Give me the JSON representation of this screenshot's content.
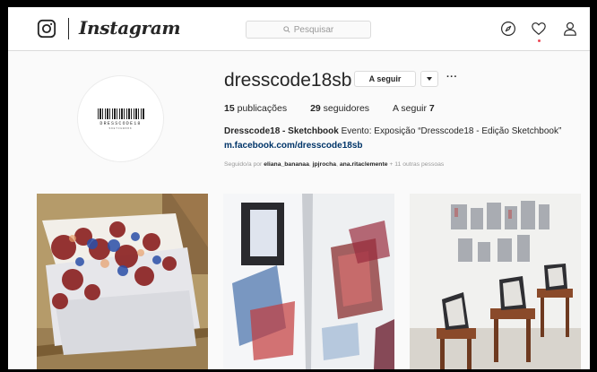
{
  "app": {
    "logo_text": "Instagram"
  },
  "search": {
    "placeholder": "Pesquisar"
  },
  "nav": {
    "icons": [
      "compass-icon",
      "heart-icon",
      "user-icon"
    ]
  },
  "avatar": {
    "caption": "DRESSCODE18",
    "subcaption": "SKETCHBOOK"
  },
  "profile": {
    "username": "dresscode18sb",
    "follow_label": "A seguir",
    "more_label": "···",
    "stats": {
      "posts_count": "15",
      "posts_label": "publicações",
      "followers_count": "29",
      "followers_label": "seguidores",
      "following_label": "A seguir",
      "following_count": "7"
    },
    "bio_name": "Dresscode18 - Sketchbook",
    "bio_text": " Evento: Exposição “Dresscode18 - Edição Sketchbook”",
    "link": "m.facebook.com/dresscode18sb",
    "followed_by": {
      "prefix": "Seguido/a por ",
      "names": [
        "eliana_bananaa",
        "jpjrocha",
        "ana.ritaclemente"
      ],
      "sep": ", ",
      "suffix": " + 11 outras pessoas"
    }
  },
  "colors": {
    "accent_link": "#003569",
    "notification_dot": "#ed4956",
    "border": "#dbdbdb"
  }
}
